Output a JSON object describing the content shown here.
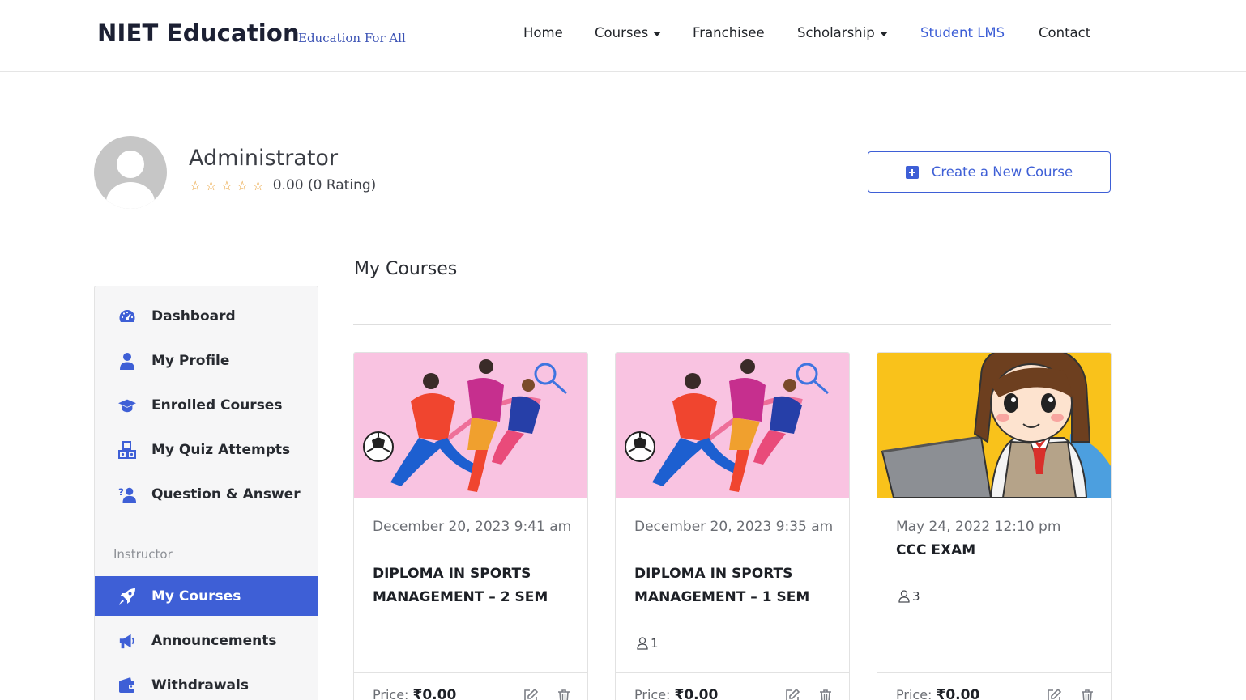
{
  "header": {
    "brand": "NIET Education",
    "tagline": "Education For All",
    "nav": [
      {
        "label": "Home"
      },
      {
        "label": "Courses"
      },
      {
        "label": "Franchisee"
      },
      {
        "label": "Scholarship"
      },
      {
        "label": "Student LMS"
      },
      {
        "label": "Contact"
      }
    ]
  },
  "profile": {
    "name": "Administrator",
    "rating_text": "0.00 (0 Rating)",
    "stars": 0,
    "create_button": "Create a New Course"
  },
  "sidebar": {
    "items": [
      {
        "label": "Dashboard",
        "icon": "dashboard-icon"
      },
      {
        "label": "My Profile",
        "icon": "user-icon"
      },
      {
        "label": "Enrolled Courses",
        "icon": "graduation-cap-icon"
      },
      {
        "label": "My Quiz Attempts",
        "icon": "quiz-icon"
      },
      {
        "label": "Question & Answer",
        "icon": "question-answer-icon"
      }
    ],
    "instructor_heading": "Instructor",
    "instructor_items": [
      {
        "label": "My Courses",
        "icon": "rocket-icon",
        "active": true
      },
      {
        "label": "Announcements",
        "icon": "megaphone-icon"
      },
      {
        "label": "Withdrawals",
        "icon": "wallet-icon"
      }
    ]
  },
  "main": {
    "title": "My Courses",
    "courses": [
      {
        "date": "December 20, 2023 9:41 am",
        "title": "DIPLOMA IN SPORTS MANAGEMENT – 2 SEM",
        "students": "",
        "price_label": "Price:",
        "price": "₹0.00",
        "thumbnail": "sports-illustration"
      },
      {
        "date": "December 20, 2023 9:35 am",
        "title": "DIPLOMA IN SPORTS MANAGEMENT – 1 SEM",
        "students": "1",
        "price_label": "Price:",
        "price": "₹0.00",
        "thumbnail": "sports-illustration"
      },
      {
        "date": "May 24, 2022 12:10 pm",
        "title": "CCC EXAM",
        "students": "3",
        "price_label": "Price:",
        "price": "₹0.00",
        "thumbnail": "student-laptop-illustration"
      }
    ]
  },
  "colors": {
    "accent": "#3e5fd6",
    "star": "#e89b2c",
    "sports_bg": "#f9c3e1",
    "exam_bg": "#f9c21b"
  }
}
